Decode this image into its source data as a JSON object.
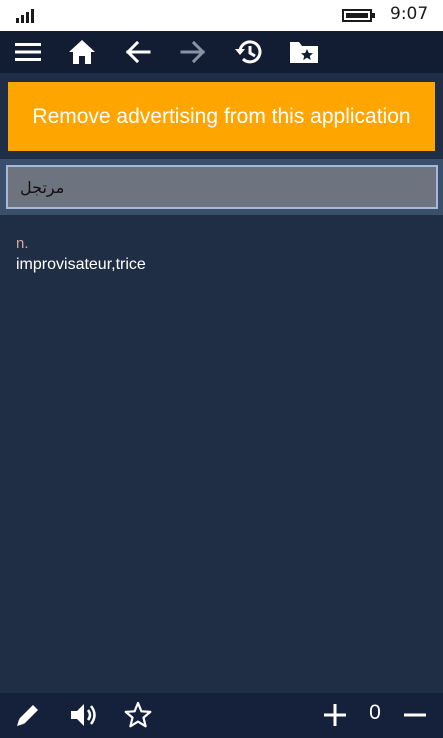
{
  "status_bar": {
    "time": "9:07",
    "signal_icon": "signal-bars-icon",
    "battery_icon": "battery-icon"
  },
  "toolbar": {
    "icons": [
      "menu-icon",
      "home-icon",
      "back-arrow-icon",
      "forward-arrow-icon",
      "history-icon",
      "favorites-folder-icon"
    ],
    "forward_enabled": false
  },
  "ad_banner": {
    "label": "Remove advertising from this application",
    "color": "#ffa500"
  },
  "search": {
    "value": "مرتجل"
  },
  "entry": {
    "part_of_speech": "n.",
    "translation": "improvisateur,trice"
  },
  "bottom_bar": {
    "icons": [
      "edit-pencil-icon",
      "speaker-icon",
      "star-icon",
      "plus-icon",
      "minus-icon"
    ],
    "counter": "0"
  },
  "colors": {
    "background": "#1f2d45",
    "toolbar": "#121d33",
    "accent": "#ffa500",
    "part_of_speech": "#d3a9a0"
  }
}
